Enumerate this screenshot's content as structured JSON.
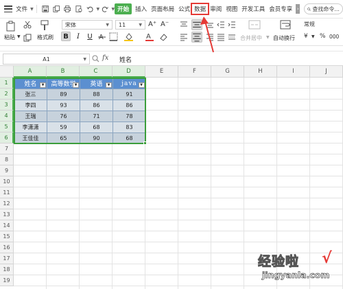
{
  "menubar": {
    "file_label": "文件",
    "tabs": [
      "开始",
      "插入",
      "页面布局",
      "公式",
      "数据",
      "审阅",
      "视图",
      "开发工具",
      "会员专享"
    ],
    "search_placeholder": "查找命令..."
  },
  "ribbon": {
    "paste_label": "粘贴",
    "format_painter_label": "格式刷",
    "font_name": "宋体",
    "font_size": "11",
    "bold_label": "B",
    "italic_label": "I",
    "underline_label": "U",
    "font_grow_label": "A⁺",
    "font_shrink_label": "A⁻",
    "merge_label": "合并居中",
    "wrap_label": "自动换行",
    "number_format": "常规",
    "currency_label": "¥",
    "percent_label": "%",
    "thousands_label": "000"
  },
  "formula_bar": {
    "cell_ref": "A1",
    "fx_label": "fx",
    "value": "姓名"
  },
  "columns": [
    "A",
    "B",
    "C",
    "D",
    "E",
    "F",
    "G",
    "H",
    "I",
    "J"
  ],
  "rows": [
    "1",
    "2",
    "3",
    "4",
    "5",
    "6",
    "7",
    "8",
    "9",
    "10",
    "11",
    "12",
    "13",
    "14",
    "15",
    "16",
    "17",
    "18",
    "19"
  ],
  "table": {
    "headers": [
      "姓名",
      "高等数学",
      "英语",
      "java"
    ],
    "rows": [
      [
        "张三",
        "89",
        "88",
        "91"
      ],
      [
        "李四",
        "93",
        "86",
        "86"
      ],
      [
        "王瑞",
        "76",
        "71",
        "78"
      ],
      [
        "李潇潇",
        "59",
        "68",
        "83"
      ],
      [
        "王佳佳",
        "65",
        "90",
        "68"
      ]
    ]
  },
  "colors": {
    "start_tab": "#4caf50",
    "header_fill": "#5b8fd0",
    "selection_border": "#3a9d3a",
    "highlight": "#e53935"
  },
  "watermark": {
    "text": "经验啦",
    "check": "√",
    "url": "jingyanla.com"
  }
}
